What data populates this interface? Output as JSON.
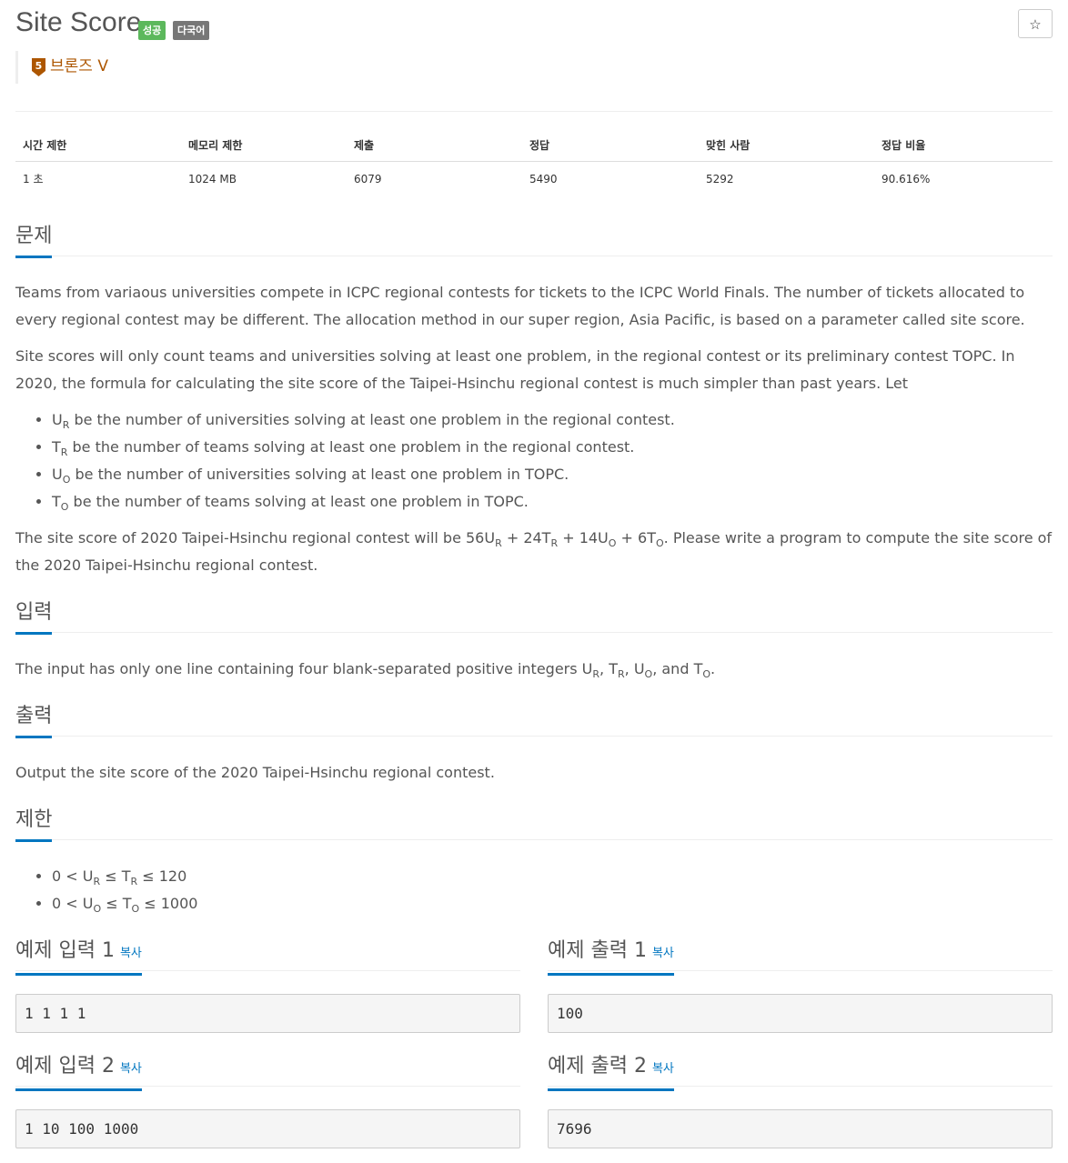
{
  "header": {
    "title": "Site Score",
    "badges": [
      "성공",
      "다국어"
    ],
    "star": "☆",
    "tier": {
      "level": "5",
      "label": "브론즈 V",
      "color": "#ad5600"
    }
  },
  "info": {
    "headers": [
      "시간 제한",
      "메모리 제한",
      "제출",
      "정답",
      "맞힌 사람",
      "정답 비율"
    ],
    "values": [
      "1 초",
      "1024 MB",
      "6079",
      "5490",
      "5292",
      "90.616%"
    ]
  },
  "problem": {
    "heading": "문제",
    "p1": "Teams from variaous universities compete in ICPC regional contests for tickets to the ICPC World Finals. The number of tickets allocated to every regional contest may be different. The allocation method in our super region, Asia Pacific, is based on a parameter called site score.",
    "p2": "Site scores will only count teams and universities solving at least one problem, in the regional contest or its preliminary contest TOPC. In 2020, the formula for calculating the site score of the Taipei-Hsinchu regional contest is much simpler than past years. Let",
    "bullets": [
      {
        "sym": "U",
        "sub": "R",
        "text": " be the number of universities solving at least one problem in the regional contest."
      },
      {
        "sym": "T",
        "sub": "R",
        "text": " be the number of teams solving at least one problem in the regional contest."
      },
      {
        "sym": "U",
        "sub": "O",
        "text": " be the number of universities solving at least one problem in TOPC."
      },
      {
        "sym": "T",
        "sub": "O",
        "text": " be the number of teams solving at least one problem in TOPC."
      }
    ],
    "p3_a": "The site score of 2020 Taipei-Hsinchu regional contest will be 56U",
    "p3_b": " + 24T",
    "p3_c": " + 14U",
    "p3_d": " + 6T",
    "p3_e": ". Please write a program to compute the site score of the 2020 Taipei-Hsinchu regional contest.",
    "sub_r": "R",
    "sub_o": "O"
  },
  "input": {
    "heading": "입력",
    "text_a": "The input has only one line containing four blank-separated positive integers U",
    "text_b": ", T",
    "text_c": ", U",
    "text_d": ", and T",
    "text_e": "."
  },
  "output": {
    "heading": "출력",
    "text": "Output the site score of the 2020 Taipei-Hsinchu regional contest."
  },
  "limits": {
    "heading": "제한",
    "l1_a": "0 < U",
    "l1_b": " ≤ T",
    "l1_c": " ≤ 120",
    "l2_a": "0 < U",
    "l2_b": " ≤ T",
    "l2_c": " ≤ 1000"
  },
  "samples": {
    "copy": "복사",
    "in1": {
      "heading": "예제 입력 1",
      "value": "1 1 1 1"
    },
    "out1": {
      "heading": "예제 출력 1",
      "value": "100"
    },
    "in2": {
      "heading": "예제 입력 2",
      "value": "1 10 100 1000"
    },
    "out2": {
      "heading": "예제 출력 2",
      "value": "7696"
    }
  }
}
